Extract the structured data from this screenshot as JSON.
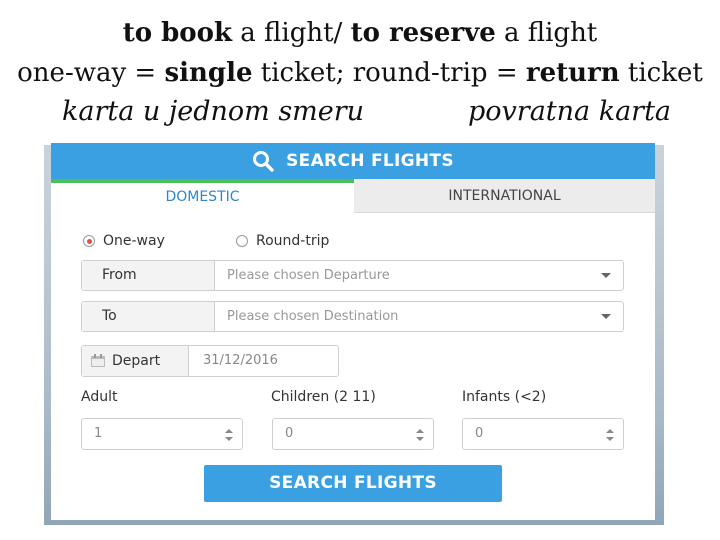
{
  "heading": {
    "line1": {
      "b1": "to book",
      "t1": " a flight/ ",
      "b2": "to reserve",
      "t2": " a flight"
    },
    "line2": {
      "t1": "one-way = ",
      "b1": "single",
      "t2": " ticket; round-trip = ",
      "b2": "return",
      "t3": " ticket"
    },
    "line3": {
      "left": "karta u jednom smeru",
      "right": "povratna karta"
    }
  },
  "widget": {
    "title": "SEARCH FLIGHTS",
    "tabs": {
      "domestic": "DOMESTIC",
      "international": "INTERNATIONAL"
    },
    "trip_type": {
      "one_way": "One-way",
      "round_trip": "Round-trip",
      "selected": "One-way"
    },
    "from": {
      "label": "From",
      "value": "Please chosen Departure"
    },
    "to": {
      "label": "To",
      "value": "Please chosen Destination"
    },
    "depart": {
      "label": "Depart",
      "value": "31/12/2016"
    },
    "passengers": {
      "adult": {
        "label": "Adult",
        "value": "1"
      },
      "children": {
        "label": "Children (2 11)",
        "value": "0"
      },
      "infants": {
        "label": "Infants (<2)",
        "value": "0"
      }
    },
    "button": "SEARCH FLIGHTS",
    "colors": {
      "header": "#3aa0e2",
      "tab_accent": "#4bbf5a",
      "radio_on": "#e74c3c"
    }
  }
}
